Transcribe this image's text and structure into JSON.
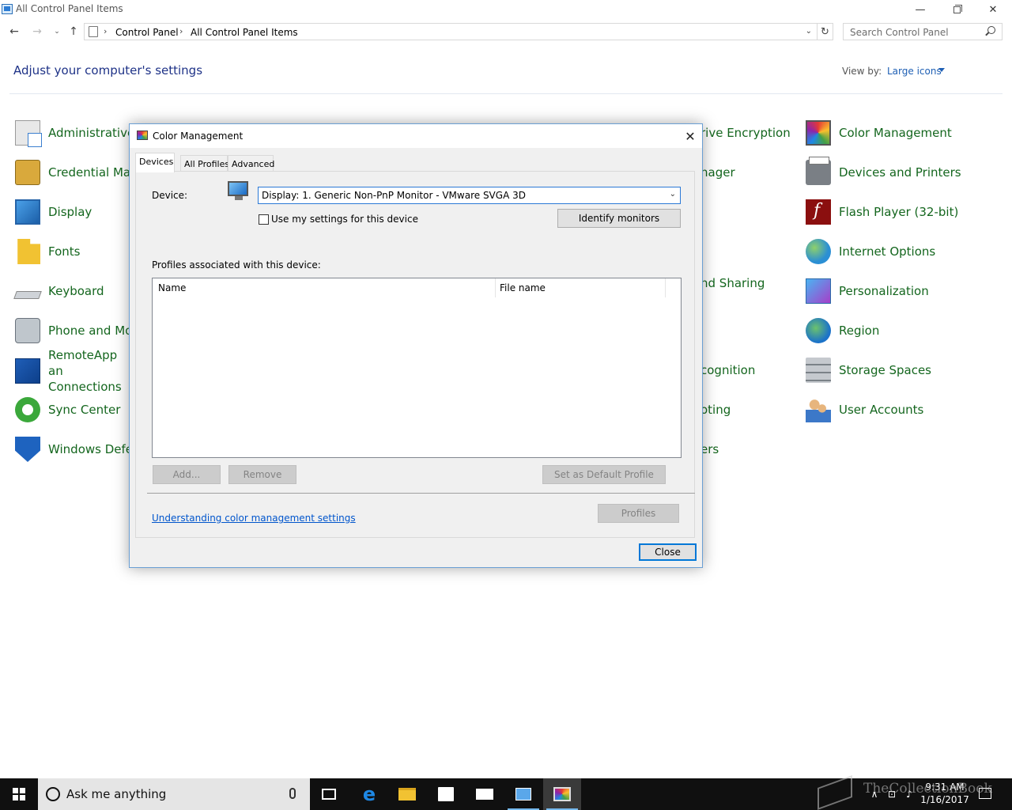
{
  "window": {
    "title": "All Control Panel Items",
    "minimize_glyph": "—",
    "close_glyph": "✕"
  },
  "nav": {
    "back_glyph": "←",
    "forward_glyph": "→",
    "recent_glyph": "⌄",
    "up_glyph": "↑",
    "breadcrumb_sep": "›",
    "breadcrumb": [
      "Control Panel",
      "All Control Panel Items"
    ],
    "address_dropdown_glyph": "⌄",
    "refresh_glyph": "↻",
    "search_placeholder": "Search Control Panel"
  },
  "page": {
    "heading": "Adjust your computer's settings",
    "view_by_label": "View by:",
    "view_by_value": "Large icons"
  },
  "left_items": [
    {
      "label": "Administrative",
      "icon": "admin-tools-icon"
    },
    {
      "label": "Credential Mar",
      "icon": "credential-manager-icon"
    },
    {
      "label": "Display",
      "icon": "display-icon"
    },
    {
      "label": "Fonts",
      "icon": "fonts-icon"
    },
    {
      "label": "Keyboard",
      "icon": "keyboard-icon"
    },
    {
      "label": "Phone and Mo",
      "icon": "phone-modem-icon"
    },
    {
      "label": "RemoteApp an Connections",
      "icon": "remoteapp-icon"
    },
    {
      "label": "Sync Center",
      "icon": "sync-center-icon"
    },
    {
      "label": "Windows Defe",
      "icon": "windows-defender-icon"
    }
  ],
  "middle_fragments": [
    "rive Encryption",
    "nager",
    "nd Sharing",
    "cognition",
    "oting",
    "ers"
  ],
  "right_items": [
    {
      "label": "Color Management",
      "icon": "color-management-icon"
    },
    {
      "label": "Devices and Printers",
      "icon": "devices-printers-icon"
    },
    {
      "label": "Flash Player (32-bit)",
      "icon": "flash-player-icon"
    },
    {
      "label": "Internet Options",
      "icon": "internet-options-icon"
    },
    {
      "label": "Personalization",
      "icon": "personalization-icon"
    },
    {
      "label": "Region",
      "icon": "region-icon"
    },
    {
      "label": "Storage Spaces",
      "icon": "storage-spaces-icon"
    },
    {
      "label": "User Accounts",
      "icon": "user-accounts-icon"
    }
  ],
  "dialog": {
    "title": "Color Management",
    "close_glyph": "✕",
    "tabs": [
      "Devices",
      "All Profiles",
      "Advanced"
    ],
    "device_label": "Device:",
    "device_value": "Display: 1. Generic Non-PnP Monitor - VMware SVGA 3D",
    "select_caret_glyph": "⌄",
    "use_my_settings_label": "Use my settings for this device",
    "use_my_settings_checked": false,
    "identify_button": "Identify monitors",
    "profiles_label": "Profiles associated with this device:",
    "columns": [
      "Name",
      "File name"
    ],
    "rows": [],
    "add_button": "Add...",
    "remove_button": "Remove",
    "set_default_button": "Set as Default Profile",
    "help_link": "Understanding color management settings",
    "profiles_button": "Profiles",
    "close_button": "Close"
  },
  "taskbar": {
    "search_placeholder": "Ask me anything",
    "time": "9:31 AM",
    "date": "1/16/2017",
    "tray_glyphs": [
      "∧",
      "⊡",
      "♪"
    ]
  },
  "watermark": "TheCollectionBook",
  "colors": {
    "link_green": "#14661e",
    "heading_blue": "#1e3287",
    "taskbar": "#101010",
    "accent": "#0078d7"
  }
}
